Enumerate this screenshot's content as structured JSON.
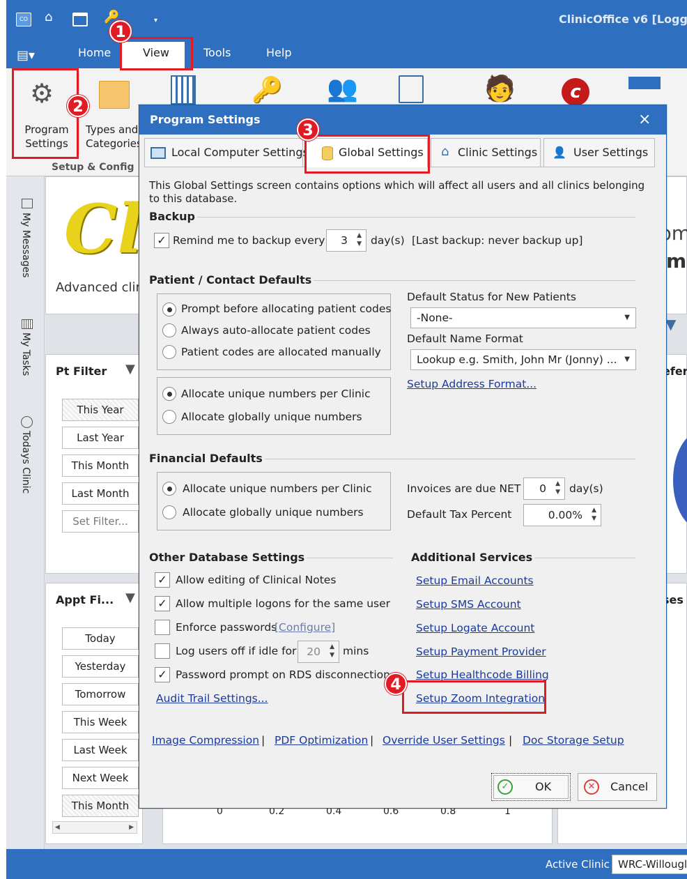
{
  "app": {
    "title": "ClinicOffice v6 [Logge",
    "menu": [
      "Home",
      "View",
      "Tools",
      "Help"
    ],
    "qat_icons": [
      "app-logo-icon",
      "home-icon",
      "calendar-icon",
      "key-icon",
      "dropdown-arrow-icon"
    ]
  },
  "ribbon": {
    "program_settings": "Program Settings",
    "types_categories": "Types and Categories",
    "group_label": "Setup & Config"
  },
  "sidestrip": {
    "my_messages": "My Messages",
    "my_tasks": "My Tasks",
    "todays_clinic": "Todays Clinic"
  },
  "background": {
    "logo_letters": "Cli",
    "advanced_text": "Advanced clir",
    "right_text_1": "pm",
    "right_text_2": "m",
    "pt_filter": "Pt Filter",
    "pt_filters": [
      "This Year",
      "Last Year",
      "This Month",
      "Last Month",
      "Set Filter..."
    ],
    "appt_filter": "Appt Fi...",
    "appt_filters": [
      "Today",
      "Yesterday",
      "Tomorrow",
      "This Week",
      "Last Week",
      "Next Week",
      "This Month"
    ],
    "chart_ticks": [
      "0",
      "0.2",
      "0.4",
      "0.6",
      "0.8",
      "1"
    ],
    "refer_text": "efer",
    "uses_text": "ses"
  },
  "status": {
    "active_clinic_label": "Active Clinic",
    "active_clinic_value": "WRC-Willougl"
  },
  "dialog": {
    "title": "Program Settings",
    "close": "×",
    "tabs": [
      "Local Computer Settings",
      "Global Settings",
      "Clinic Settings",
      "User Settings"
    ],
    "intro": "This Global Settings screen contains options which will affect all users and all clinics belonging to this database.",
    "backup": {
      "heading": "Backup",
      "remind_label": "Remind me to backup every",
      "days_value": "3",
      "days_unit": "day(s)",
      "last_backup": "[Last backup: never backup up]"
    },
    "patient": {
      "heading": "Patient / Contact Defaults",
      "code_options": [
        "Prompt before allocating patient codes",
        "Always auto-allocate patient codes",
        "Patient codes are allocated manually"
      ],
      "number_options": [
        "Allocate unique numbers per Clinic",
        "Allocate globally unique numbers"
      ],
      "status_label": "Default Status for New Patients",
      "status_value": "-None-",
      "name_format_label": "Default Name Format",
      "name_format_value": "Lookup e.g. Smith, John Mr (Jonny) ...",
      "address_link": "Setup Address Format..."
    },
    "financial": {
      "heading": "Financial Defaults",
      "options": [
        "Allocate unique numbers per Clinic",
        "Allocate globally unique numbers"
      ],
      "invoice_label": "Invoices are due NET",
      "invoice_value": "0",
      "invoice_unit": "day(s)",
      "tax_label": "Default Tax Percent",
      "tax_value": "0.00%"
    },
    "other": {
      "heading": "Other Database Settings",
      "allow_edit": "Allow editing of Clinical Notes",
      "allow_multi": "Allow multiple logons for the same user",
      "enforce": "Enforce passwords",
      "configure": "[Configure]",
      "logoff": "Log users off if idle for",
      "idle_value": "20",
      "idle_unit": "mins",
      "rds": "Password prompt on RDS disconnection",
      "audit_link": "Audit Trail Settings..."
    },
    "additional": {
      "heading": "Additional Services",
      "links": [
        "Setup Email Accounts",
        "Setup SMS Account",
        "Setup Logate Account",
        "Setup Payment Provider",
        "Setup Healthcode Billing",
        "Setup Zoom Integration"
      ]
    },
    "bottom_links": [
      "Image Compression",
      "PDF Optimization",
      "Override User Settings",
      "Doc Storage Setup"
    ],
    "separator": "|",
    "ok": "OK",
    "cancel": "Cancel"
  },
  "annotations": [
    "1",
    "2",
    "3",
    "4"
  ],
  "colors": {
    "title_blue": "#2e6fbf",
    "annotation_red": "#e01b24",
    "link_blue": "#1a3a9a"
  }
}
